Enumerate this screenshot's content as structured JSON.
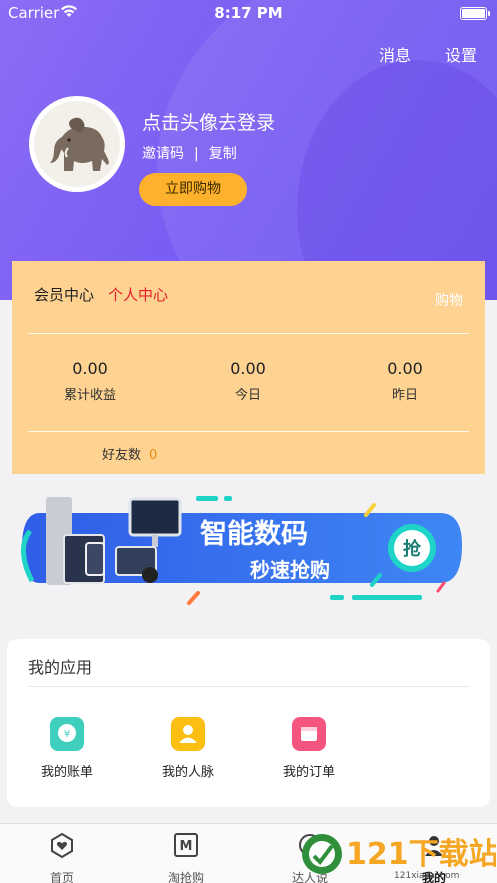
{
  "status_bar": {
    "carrier": "Carrier",
    "time": "8:17 PM"
  },
  "header": {
    "messages": "消息",
    "settings": "设置",
    "login_prompt": "点击头像去登录",
    "invite_code": "邀请码",
    "separator": "|",
    "copy": "复制",
    "shop_now": "立即购物"
  },
  "member": {
    "title": "会员中心",
    "subtitle": "个人中心",
    "shop": "购物",
    "stats": [
      {
        "value": "0.00",
        "label": "累计收益"
      },
      {
        "value": "0.00",
        "label": "今日"
      },
      {
        "value": "0.00",
        "label": "昨日"
      }
    ],
    "friends_label": "好友数",
    "friends_count": "0"
  },
  "banner": {
    "headline": "智能数码",
    "sub": "秒速抢购",
    "badge": "抢"
  },
  "apps": {
    "title": "我的应用",
    "items": [
      {
        "label": "我的账单",
        "color": "#3ecfbf"
      },
      {
        "label": "我的人脉",
        "color": "#fbbf12"
      },
      {
        "label": "我的订单",
        "color": "#f4557e"
      }
    ]
  },
  "tabbar": {
    "items": [
      {
        "label": "首页"
      },
      {
        "label": "淘抢购"
      },
      {
        "label": "达人说"
      },
      {
        "label": "我的"
      }
    ]
  },
  "watermark": {
    "text": "121下载站",
    "url": "121xiazai.com"
  }
}
